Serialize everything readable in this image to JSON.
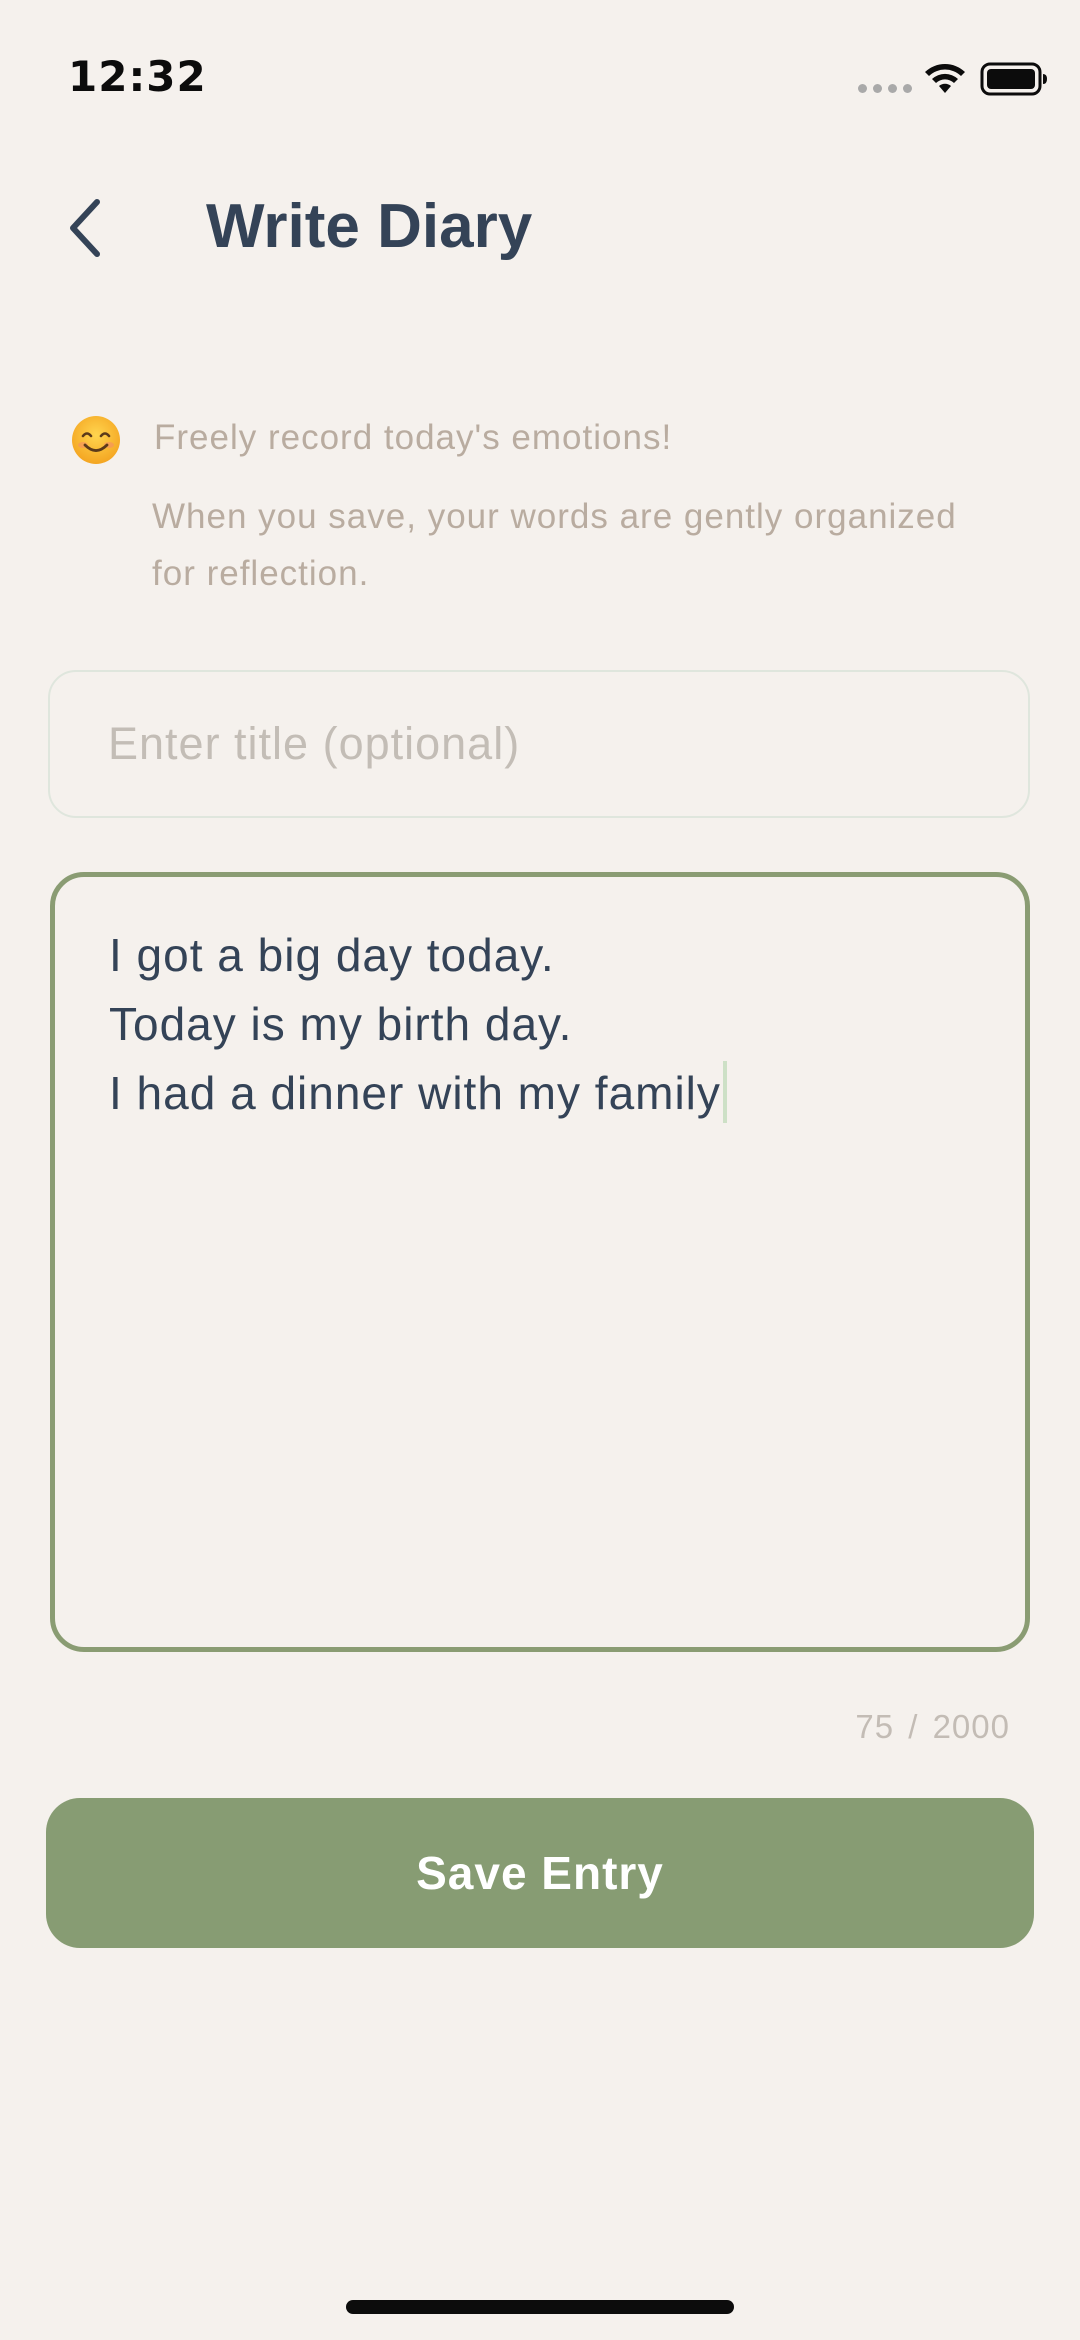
{
  "status_bar": {
    "time": "12:32",
    "icons": [
      "signal-dots-icon",
      "wifi-icon",
      "battery-icon"
    ]
  },
  "header": {
    "back_icon": "chevron-left-icon",
    "title": "Write Diary"
  },
  "intro": {
    "emoji": "smiling-face-emoji",
    "headline": "Freely record today's emotions!",
    "body": "When you save, your words are gently organized for reflection."
  },
  "title_field": {
    "placeholder": "Enter title (optional)",
    "value": ""
  },
  "body_field": {
    "lines": [
      "I got a big day today.",
      "Today is my birth day.",
      "I had a dinner with my family"
    ]
  },
  "char_count": {
    "current": "75",
    "separator": "/",
    "max": "2000"
  },
  "save_button": {
    "label": "Save Entry"
  },
  "colors": {
    "background": "#f5f1ed",
    "title_text": "#344357",
    "hint_text": "#b9aca0",
    "accent_green": "#879c73",
    "field_border": "#8a9c73",
    "caret": "#cde0c6"
  }
}
